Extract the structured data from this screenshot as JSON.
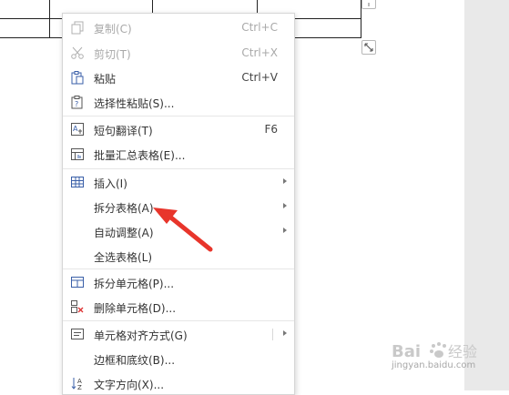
{
  "menu": {
    "items": [
      {
        "label": "复制(C)",
        "shortcut": "Ctrl+C",
        "icon": "copy-icon",
        "disabled": true
      },
      {
        "label": "剪切(T)",
        "shortcut": "Ctrl+X",
        "icon": "scissors-icon",
        "disabled": true
      },
      {
        "label": "粘贴",
        "shortcut": "Ctrl+V",
        "icon": "paste-icon"
      },
      {
        "label": "选择性粘贴(S)...",
        "icon": "paste-special-icon"
      },
      {
        "label": "短句翻译(T)",
        "shortcut": "F6",
        "icon": "translate-icon"
      },
      {
        "label": "批量汇总表格(E)...",
        "icon": "batch-summary-icon"
      },
      {
        "label": "插入(I)",
        "icon": "table-insert-icon",
        "submenu": true
      },
      {
        "label": "拆分表格(A)",
        "submenu": true
      },
      {
        "label": "自动调整(A)",
        "submenu": true
      },
      {
        "label": "全选表格(L)"
      },
      {
        "label": "拆分单元格(P)...",
        "icon": "split-cells-icon"
      },
      {
        "label": "删除单元格(D)...",
        "icon": "delete-cells-icon"
      },
      {
        "label": "单元格对齐方式(G)",
        "icon": "cell-align-icon",
        "submenu": true
      },
      {
        "label": "边框和底纹(B)..."
      },
      {
        "label": "文字方向(X)...",
        "icon": "text-direction-icon"
      }
    ]
  },
  "watermark": {
    "domain": "jingyan.baidu.com",
    "logo": "Baidu 经验"
  },
  "colors": {
    "arrow": "#e8352b",
    "menu_border": "#d6d6d6",
    "disabled_text": "#a9a9a9"
  }
}
